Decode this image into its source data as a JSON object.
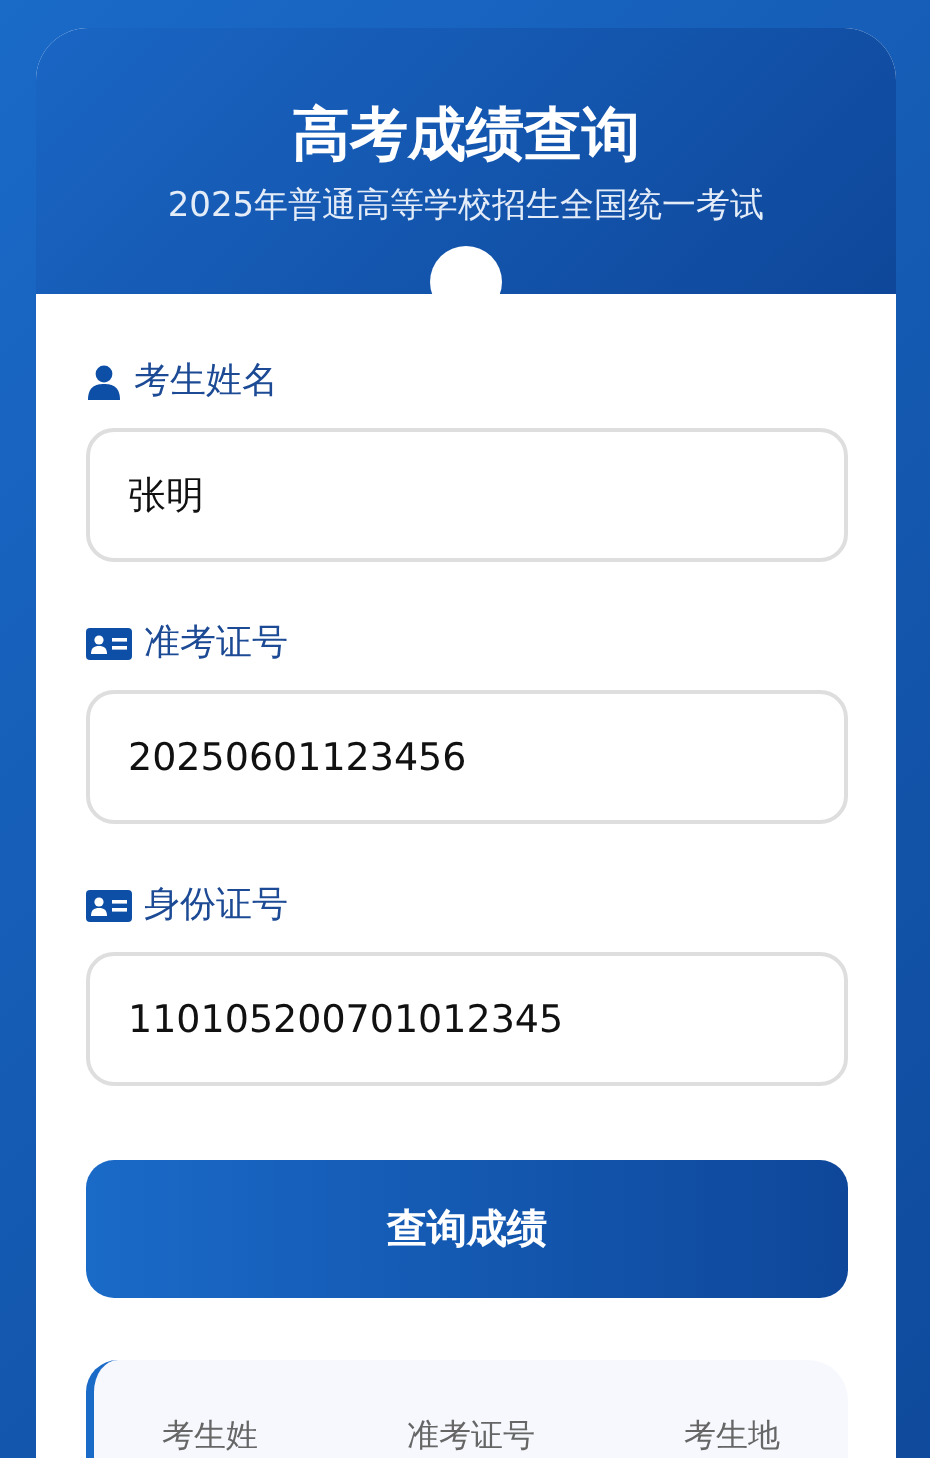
{
  "header": {
    "title": "高考成绩查询",
    "subtitle": "2025年普通高等学校招生全国统一考试"
  },
  "fields": [
    {
      "label": "考生姓名",
      "kind": "person",
      "value": "张明"
    },
    {
      "label": "准考证号",
      "kind": "card",
      "value": "20250601123456"
    },
    {
      "label": "身份证号",
      "kind": "card",
      "value": "110105200701012345"
    }
  ],
  "submit_button": "查询成绩",
  "results": {
    "columns": [
      "考生姓",
      "准考证号",
      "考生地"
    ]
  }
}
